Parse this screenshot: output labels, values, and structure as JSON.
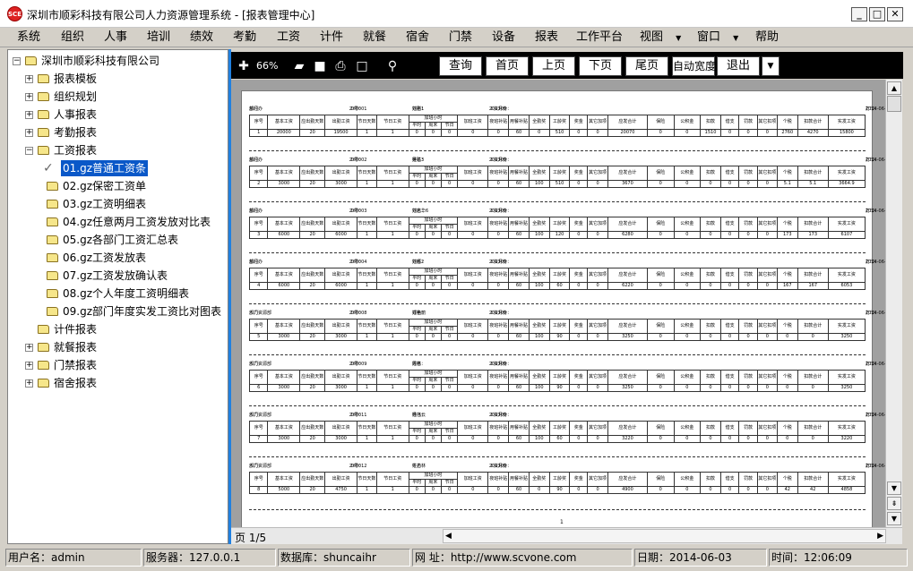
{
  "window": {
    "icon_text": "SCE",
    "title": "深圳市顺彩科技有限公司人力资源管理系统 - [报表管理中心]"
  },
  "menu": [
    "系统",
    "组织",
    "人事",
    "培训",
    "绩效",
    "考勤",
    "工资",
    "计件",
    "就餐",
    "宿舍",
    "门禁",
    "设备",
    "报表",
    "工作平台",
    "视图",
    "窗口",
    "帮助"
  ],
  "tree": {
    "root": "深圳市顺彩科技有限公司",
    "top_before": [
      "报表模板",
      "组织规划",
      "人事报表",
      "考勤报表"
    ],
    "salary": "工资报表",
    "salary_children": [
      "01.gz普通工资条",
      "02.gz保密工资单",
      "03.gz工资明细表",
      "04.gz任意两月工资发放对比表",
      "05.gz各部门工资汇总表",
      "06.gz工资发放表",
      "07.gz工资发放确认表",
      "08.gz个人年度工资明细表",
      "09.gz部门年度实发工资比对图表"
    ],
    "piece": "计件报表",
    "top_after": [
      "就餐报表",
      "门禁报表",
      "宿舍报表"
    ]
  },
  "toolbar": {
    "zoom": "66%",
    "query": "查询",
    "first": "首页",
    "prev": "上页",
    "next": "下页",
    "last": "尾页",
    "autowidth": "自动宽度",
    "exit": "退出"
  },
  "pager": {
    "page_info": "页 1/5"
  },
  "status": {
    "user": "用户名：admin",
    "server": "服务器：127.0.0.1",
    "db": "数据库：shuncaihr",
    "web": "网  址：http://www.scvone.com",
    "date": "日期：2014-06-03",
    "time": "时间：12:06:09"
  },
  "report": {
    "labels": {
      "dept": "部门：",
      "no": "工号：",
      "name": "姓名：",
      "month": "工资月份：",
      "print": "打印：",
      "page_num": "1"
    },
    "print_date": "2014-06-03",
    "h1": [
      "序号",
      "基本工资",
      "应出勤天数",
      "出勤工资",
      "节日天数",
      "节日工资",
      "加班小时",
      "加班工资",
      "夜班补贴",
      "用餐补贴",
      "全勤奖",
      "工龄奖",
      "奖金",
      "其它加项",
      "应发合计",
      "保险",
      "公积金",
      "扣款",
      "借支",
      "罚款",
      "其它扣项",
      "个税",
      "扣款合计",
      "实发工资"
    ],
    "h2": [
      "平时",
      "周末",
      "节日"
    ],
    "records": [
      {
        "dept": "总经办",
        "no": "ZK0001",
        "name": "刘刚1",
        "month": "201309",
        "row": [
          "1",
          "20000",
          "20",
          "19500",
          "1",
          "1",
          "0",
          "0",
          "0",
          "0",
          "0",
          "60",
          "0",
          "510",
          "0",
          "0",
          "20070",
          "0",
          "0",
          "1510",
          "0",
          "0",
          "0",
          "2760",
          "4270",
          "15800"
        ]
      },
      {
        "dept": "总经办",
        "no": "ZK0002",
        "name": "吴珐3",
        "month": "201309",
        "row": [
          "2",
          "3000",
          "20",
          "3000",
          "1",
          "1",
          "0",
          "0",
          "0",
          "0",
          "0",
          "60",
          "100",
          "510",
          "0",
          "0",
          "3670",
          "0",
          "0",
          "0",
          "0",
          "0",
          "0",
          "5.1",
          "5.1",
          "3664.9"
        ]
      },
      {
        "dept": "总经办",
        "no": "ZK0003",
        "name": "刘志华6",
        "month": "201309",
        "row": [
          "3",
          "6000",
          "20",
          "6000",
          "1",
          "1",
          "0",
          "0",
          "0",
          "0",
          "0",
          "60",
          "100",
          "120",
          "0",
          "0",
          "6280",
          "0",
          "0",
          "0",
          "0",
          "0",
          "0",
          "173",
          "173",
          "6107"
        ]
      },
      {
        "dept": "总经办",
        "no": "ZK0004",
        "name": "刘辉2",
        "month": "201309",
        "row": [
          "4",
          "6000",
          "20",
          "6000",
          "1",
          "1",
          "0",
          "0",
          "0",
          "0",
          "0",
          "60",
          "100",
          "60",
          "0",
          "0",
          "6220",
          "0",
          "0",
          "0",
          "0",
          "0",
          "0",
          "167",
          "167",
          "6053"
        ]
      },
      {
        "dept": "人力资源部",
        "no": "ZK0008",
        "name": "郑艳丽",
        "month": "201309",
        "row": [
          "5",
          "3000",
          "20",
          "3000",
          "1",
          "1",
          "0",
          "0",
          "0",
          "0",
          "0",
          "60",
          "100",
          "90",
          "0",
          "0",
          "3250",
          "0",
          "0",
          "0",
          "0",
          "0",
          "0",
          "0",
          "0",
          "3250"
        ]
      },
      {
        "dept": "人力资源部",
        "no": "ZK0009",
        "name": "周林",
        "month": "201309",
        "row": [
          "6",
          "3000",
          "20",
          "3000",
          "1",
          "1",
          "0",
          "0",
          "0",
          "0",
          "0",
          "60",
          "100",
          "90",
          "0",
          "0",
          "3250",
          "0",
          "0",
          "0",
          "0",
          "0",
          "0",
          "0",
          "0",
          "3250"
        ]
      },
      {
        "dept": "人力资源部",
        "no": "ZK0011",
        "name": "杨飞云",
        "month": "201309",
        "row": [
          "7",
          "3000",
          "20",
          "3000",
          "1",
          "1",
          "0",
          "0",
          "0",
          "0",
          "0",
          "60",
          "100",
          "60",
          "0",
          "0",
          "3220",
          "0",
          "0",
          "0",
          "0",
          "0",
          "0",
          "0",
          "0",
          "3220"
        ]
      },
      {
        "dept": "人力资源部",
        "no": "ZK0012",
        "name": "牛力林",
        "month": "201309",
        "row": [
          "8",
          "5000",
          "20",
          "4750",
          "1",
          "1",
          "0",
          "0",
          "0",
          "0",
          "0",
          "60",
          "0",
          "90",
          "0",
          "0",
          "4900",
          "0",
          "0",
          "0",
          "0",
          "0",
          "0",
          "42",
          "42",
          "4858"
        ]
      }
    ]
  }
}
